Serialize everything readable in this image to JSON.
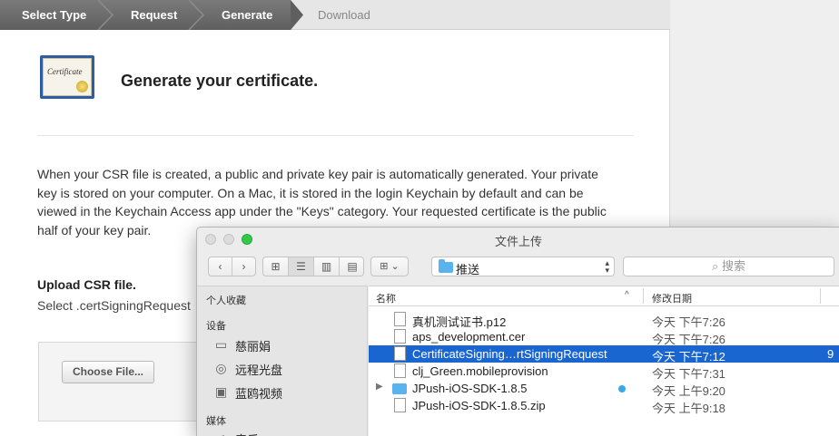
{
  "web": {
    "steps": [
      "Select Type",
      "Request",
      "Generate",
      "Download"
    ],
    "certificate_icon_text": "Certificate",
    "title": "Generate your certificate.",
    "paragraph": "When your CSR file is created, a public and private key pair is automatically generated. Your private key is stored on your computer. On a Mac, it is stored in the login Keychain by default and can be viewed in the Keychain Access app under the \"Keys\" category. Your requested certificate is the public half of your key pair.",
    "upload_title": "Upload CSR file.",
    "upload_sub": "Select .certSigningRequest",
    "choose_button": "Choose File..."
  },
  "dialog": {
    "title": "文件上传",
    "path": "推送",
    "search_placeholder": "搜索",
    "sidebar": {
      "favorites_header": "个人收藏",
      "devices_header": "设备",
      "devices": [
        {
          "label": "慈丽娟",
          "icon": "hard-drive-icon"
        },
        {
          "label": "远程光盘",
          "icon": "disc-icon"
        },
        {
          "label": "蓝鸥视频",
          "icon": "external-drive-icon"
        }
      ],
      "media_header": "媒体",
      "media_partial": "音乐"
    },
    "columns": {
      "name": "名称",
      "date": "修改日期"
    },
    "files": [
      {
        "name": "真机测试证书.p12",
        "date": "今天 下午7:26",
        "kind": "file"
      },
      {
        "name": "aps_development.cer",
        "date": "今天 下午7:26",
        "kind": "file"
      },
      {
        "name": "CertificateSigning…rtSigningRequest",
        "date": "今天 下午7:12",
        "kind": "file",
        "selected": true,
        "extra": "9"
      },
      {
        "name": "clj_Green.mobileprovision",
        "date": "今天 下午7:31",
        "kind": "file"
      },
      {
        "name": "JPush-iOS-SDK-1.8.5",
        "date": "今天 上午9:20",
        "kind": "folder",
        "tag": true
      },
      {
        "name": "JPush-iOS-SDK-1.8.5.zip",
        "date": "今天 上午9:18",
        "kind": "file"
      }
    ]
  },
  "colors": {
    "selection": "#1a66d1",
    "folder": "#58b3ef",
    "tag": "#3aa9e6",
    "close": "#fc605c",
    "minimize": "#fdbc40",
    "zoom": "#34c84a"
  }
}
